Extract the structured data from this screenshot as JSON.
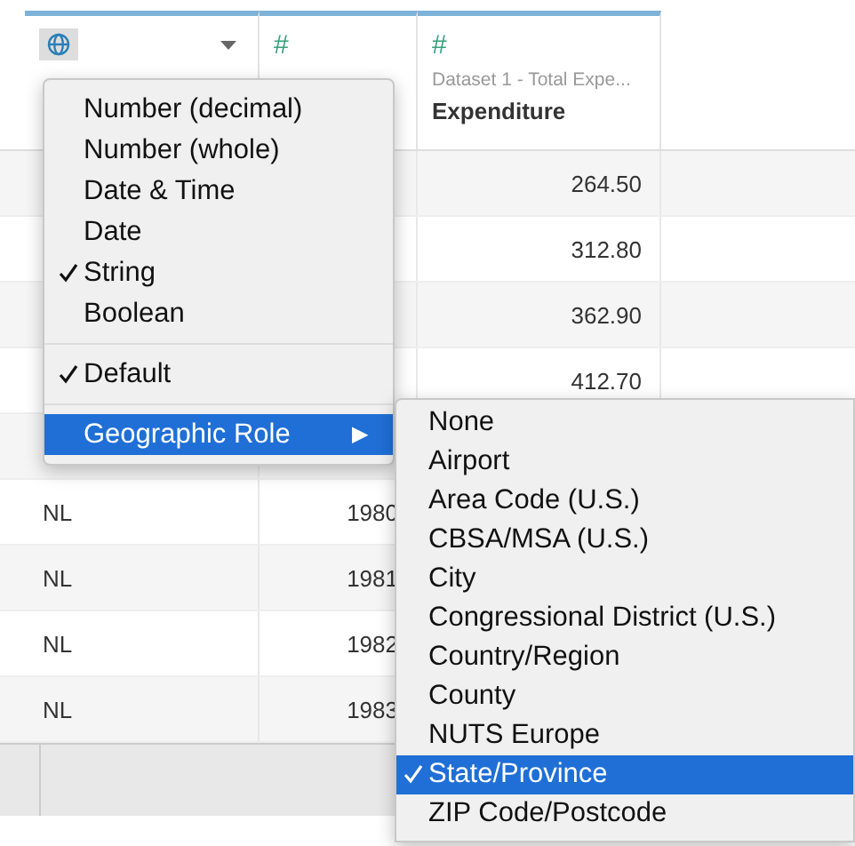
{
  "table": {
    "columns": [
      {
        "kind": "geographic",
        "has_dropdown": true
      },
      {
        "kind": "number",
        "type_symbol": "#"
      },
      {
        "kind": "number",
        "type_symbol": "#",
        "source": "Dataset 1 - Total Expe...",
        "name": "Expenditure"
      }
    ],
    "rows": [
      {
        "expenditure": "264.50"
      },
      {
        "expenditure": "312.80"
      },
      {
        "expenditure": "362.90"
      },
      {
        "expenditure": "412.70"
      },
      {},
      {
        "province": "NL",
        "year": "1980"
      },
      {
        "province": "NL",
        "year": "1981"
      },
      {
        "province": "NL",
        "year": "1982"
      },
      {
        "province": "NL",
        "year": "1983"
      }
    ]
  },
  "data_type_menu": {
    "sections": [
      {
        "items": [
          {
            "label": "Number (decimal)",
            "checked": false
          },
          {
            "label": "Number (whole)",
            "checked": false
          },
          {
            "label": "Date & Time",
            "checked": false
          },
          {
            "label": "Date",
            "checked": false
          },
          {
            "label": "String",
            "checked": true
          },
          {
            "label": "Boolean",
            "checked": false
          }
        ]
      },
      {
        "items": [
          {
            "label": "Default",
            "checked": true
          }
        ]
      },
      {
        "items": [
          {
            "label": "Geographic Role",
            "checked": false,
            "selected": true,
            "submenu_arrow": "▶"
          }
        ]
      }
    ]
  },
  "geographic_role_menu": {
    "items": [
      {
        "label": "None",
        "checked": false,
        "selected": false
      },
      {
        "label": "Airport",
        "checked": false,
        "selected": false
      },
      {
        "label": "Area Code (U.S.)",
        "checked": false,
        "selected": false
      },
      {
        "label": "CBSA/MSA (U.S.)",
        "checked": false,
        "selected": false
      },
      {
        "label": "City",
        "checked": false,
        "selected": false
      },
      {
        "label": "Congressional District (U.S.)",
        "checked": false,
        "selected": false
      },
      {
        "label": "Country/Region",
        "checked": false,
        "selected": false
      },
      {
        "label": "County",
        "checked": false,
        "selected": false
      },
      {
        "label": "NUTS Europe",
        "checked": false,
        "selected": false
      },
      {
        "label": "State/Province",
        "checked": true,
        "selected": true
      },
      {
        "label": "ZIP Code/Postcode",
        "checked": false,
        "selected": false
      }
    ]
  }
}
